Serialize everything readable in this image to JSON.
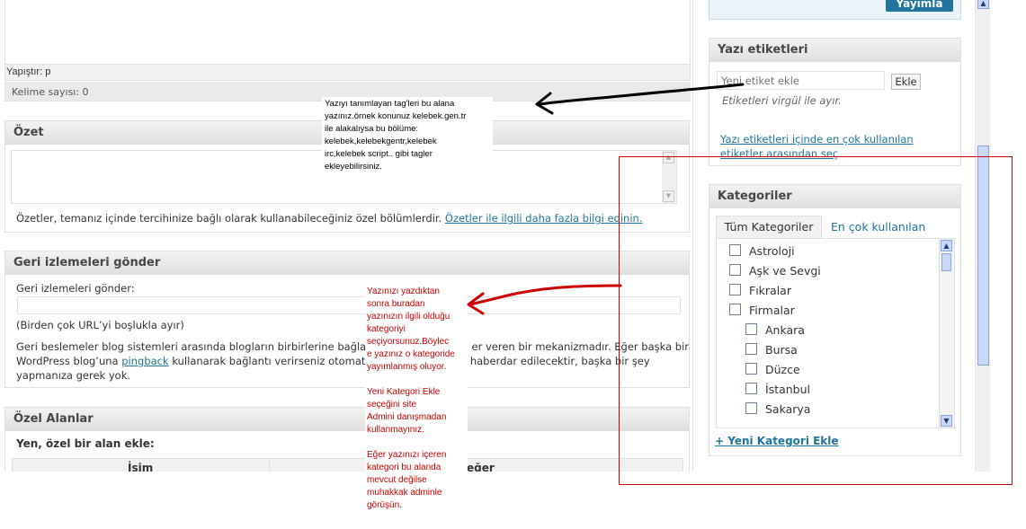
{
  "editor": {
    "path_label": "Yapıştır: p",
    "word_count": "Kelime sayısı: 0"
  },
  "excerpt": {
    "title": "Özet",
    "help": "Özetler, temanız içinde tercihinize bağlı olarak kullanabileceğiniz özel bölümlerdir.",
    "help_link": "Özetler ile ilgili daha fazla bilgi edinin."
  },
  "trackbacks": {
    "title": "Geri izlemeleri gönder",
    "label": "Geri izlemeleri gönder:",
    "hint": "(Birden çok URL’yi boşlukla ayır)",
    "desc_1a": "Geri beslemeler blog sistemleri arasında blogların birbirlerine bağlan",
    "desc_1b": "er veren bir mekanizmadır. Eğer başka bir",
    "desc_2a": "WordPress blog’una",
    "pingback": "pingback",
    "desc_2b": "kullanarak bağlantı verirseniz otomatil",
    "desc_2c": "haberdar edilecektir, başka bir şey",
    "desc_3": "yapmanıza gerek yok."
  },
  "custom_fields": {
    "title": "Özel Alanlar",
    "subtitle": "Yen, özel bir alan ekle:",
    "col_name": "İsim",
    "col_value": "eğer"
  },
  "publish": {
    "button": "Yayımla"
  },
  "tags": {
    "title": "Yazı etiketleri",
    "placeholder": "Yeni etiket ekle",
    "add_button": "Ekle",
    "hint": "Etiketleri virgül ile ayır.",
    "popular_link_1": "Yazı etiketleri içinde en çok kullanılan",
    "popular_link_2": "etiketler arasından seç"
  },
  "categories": {
    "title": "Kategoriler",
    "tab_all": "Tüm Kategoriler",
    "tab_popular": "En çok kullanılan",
    "items": [
      {
        "label": "Astroloji",
        "level": 0
      },
      {
        "label": "Aşk ve Sevgi",
        "level": 0
      },
      {
        "label": "Fıkralar",
        "level": 0
      },
      {
        "label": "Firmalar",
        "level": 0
      },
      {
        "label": "Ankara",
        "level": 1
      },
      {
        "label": "Bursa",
        "level": 1
      },
      {
        "label": "Düzce",
        "level": 1
      },
      {
        "label": "İstanbul",
        "level": 1
      },
      {
        "label": "Sakarya",
        "level": 1
      }
    ],
    "add_link": "+ Yeni Kategori Ekle"
  },
  "annotations": {
    "tags_note": [
      "Yazıyı tanımlayan tag'leri bu alana",
      "yazınız.örnek konunuz kelebek.gen.tr",
      "ile alakalıysa bu bölüme:",
      "kelebek,kelebekgentr,kelebek",
      "irc,kelebek script.. gibi tagler",
      "ekleyebilirsiniz."
    ],
    "category_note_1": [
      "Yazınızı yazdıktan",
      "sonra buradan",
      "yazınızın ilgili olduğu",
      "kategoriyi",
      "seçiyorsunuz.Böylec",
      "e yazınız o kategoride",
      "yayımlanmış oluyor."
    ],
    "category_note_2": [
      "Yeni Kategori Ekle",
      "seçeğini site",
      "Admini danışmadan",
      "kullanmayınız."
    ],
    "category_note_3": [
      "Eğer yazınızı içeren",
      "kategori bu alanda",
      "mevcut değilse",
      "muhakkak adminle",
      "görüşün."
    ],
    "colors": {
      "black_note": "#000000",
      "red_note": "#cc0000",
      "red_box": "#cc0000"
    }
  }
}
